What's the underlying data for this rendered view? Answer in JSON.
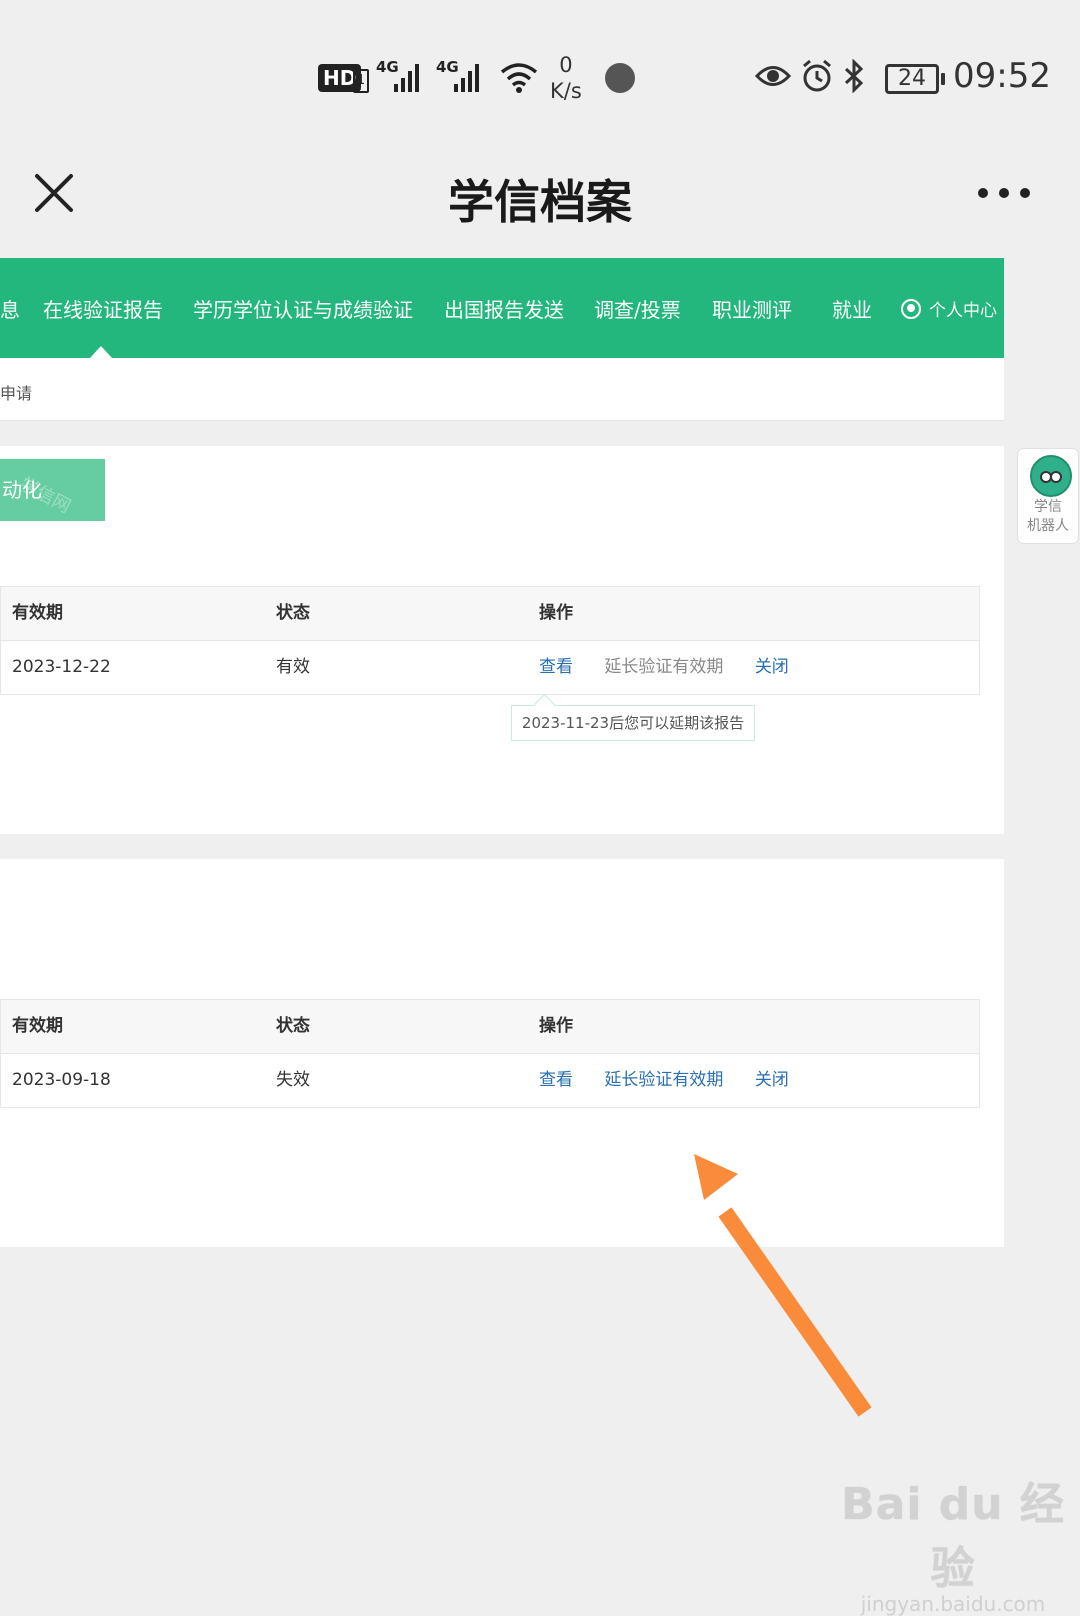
{
  "status_bar": {
    "hd_label": "HD",
    "sim_label": "1",
    "network_1": "4G",
    "network_2": "4G",
    "speed_value": "0",
    "speed_unit": "K/s",
    "battery": "24",
    "time": "09:52"
  },
  "title_bar": {
    "title": "学信档案"
  },
  "nav": {
    "items": [
      {
        "label": "息"
      },
      {
        "label": "在线验证报告"
      },
      {
        "label": "学历学位认证与成绩验证"
      },
      {
        "label": "出国报告发送"
      },
      {
        "label": "调查/投票"
      },
      {
        "label": "职业测评"
      },
      {
        "label": "就业"
      },
      {
        "label": "个人中心"
      }
    ],
    "sub_text": "申请"
  },
  "report_1": {
    "badge": "动化",
    "badge_watermark": "学信网",
    "headers": {
      "validity": "有效期",
      "status": "状态",
      "actions": "操作"
    },
    "row": {
      "validity": "2023-12-22",
      "status": "有效",
      "view": "查看",
      "extend": "延长验证有效期",
      "close": "关闭"
    },
    "tooltip": "2023-11-23后您可以延期该报告"
  },
  "report_2": {
    "headers": {
      "validity": "有效期",
      "status": "状态",
      "actions": "操作"
    },
    "row": {
      "validity": "2023-09-18",
      "status": "失效",
      "view": "查看",
      "extend": "延长验证有效期",
      "close": "关闭"
    }
  },
  "robot": {
    "label_line1": "学信",
    "label_line2": "机器人"
  },
  "watermark": {
    "brand": "Bai du 经验",
    "url": "jingyan.baidu.com"
  },
  "colors": {
    "nav_green": "#23b77d",
    "link_blue": "#2a6fb0",
    "arrow_orange": "#f98b3a"
  }
}
